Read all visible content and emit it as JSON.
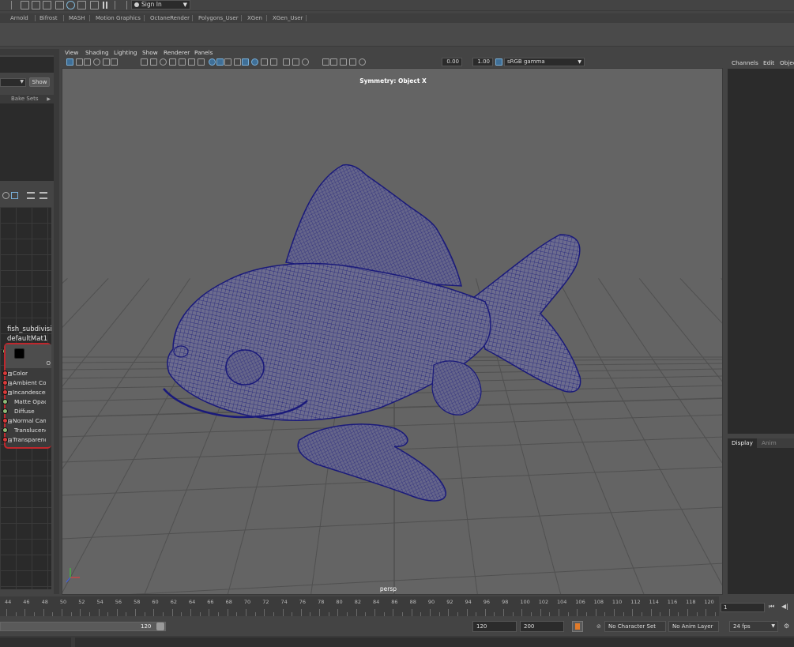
{
  "top_toolbar": {
    "sign_in_label": "Sign In"
  },
  "shelf_tabs": [
    "Arnold",
    "Bifrost",
    "MASH",
    "Motion Graphics",
    "OctaneRender",
    "Polygons_User",
    "XGen",
    "XGen_User"
  ],
  "left_panel": {
    "show_button": "Show",
    "bake_sets_tab": "Bake Sets",
    "node_title_line1": "fish_subdivisio",
    "node_title_line2": "defaultMat1",
    "node_output_label": "O",
    "node_attributes": [
      {
        "label": "Color",
        "expandable": true,
        "port_color": "#d83a3a"
      },
      {
        "label": "Ambient Colo",
        "expandable": true,
        "port_color": "#d83a3a"
      },
      {
        "label": "Incandescenc",
        "expandable": true,
        "port_color": "#d83a3a"
      },
      {
        "label": "Matte Opacity",
        "expandable": false,
        "port_color": "#8dbb78"
      },
      {
        "label": "Diffuse",
        "expandable": false,
        "port_color": "#8dbb78"
      },
      {
        "label": "Normal Came",
        "expandable": true,
        "port_color": "#d83a3a"
      },
      {
        "label": "Translucence",
        "expandable": false,
        "port_color": "#8dbb78"
      },
      {
        "label": "Transparency",
        "expandable": true,
        "port_color": "#d83a3a"
      }
    ]
  },
  "viewport": {
    "menu": [
      "View",
      "Shading",
      "Lighting",
      "Show",
      "Renderer",
      "Panels"
    ],
    "exposure_value": "0.00",
    "gamma_value": "1.00",
    "color_space": "sRGB gamma",
    "symmetry_label": "Symmetry: Object X",
    "camera_label": "persp",
    "wireframe_color": "#1a1a7a",
    "background_color": "#646464",
    "grid_color": "#505050"
  },
  "right_panel": {
    "tabs": [
      "Channels",
      "Edit",
      "Objec"
    ],
    "layer_tabs": [
      "Display",
      "Anim"
    ]
  },
  "timeline": {
    "ticks": [
      "44",
      "46",
      "48",
      "50",
      "52",
      "54",
      "56",
      "58",
      "60",
      "62",
      "64",
      "66",
      "68",
      "70",
      "72",
      "74",
      "76",
      "78",
      "80",
      "82",
      "84",
      "86",
      "88",
      "90",
      "92",
      "94",
      "96",
      "98",
      "100",
      "102",
      "104",
      "106",
      "108",
      "110",
      "112",
      "114",
      "116",
      "118",
      "120"
    ],
    "current_frame": "1"
  },
  "range": {
    "range_end_label": "120",
    "playback_end": "120",
    "animation_end": "200",
    "character_set": "No Character Set",
    "anim_layer": "No Anim Layer",
    "fps": "24 fps"
  }
}
